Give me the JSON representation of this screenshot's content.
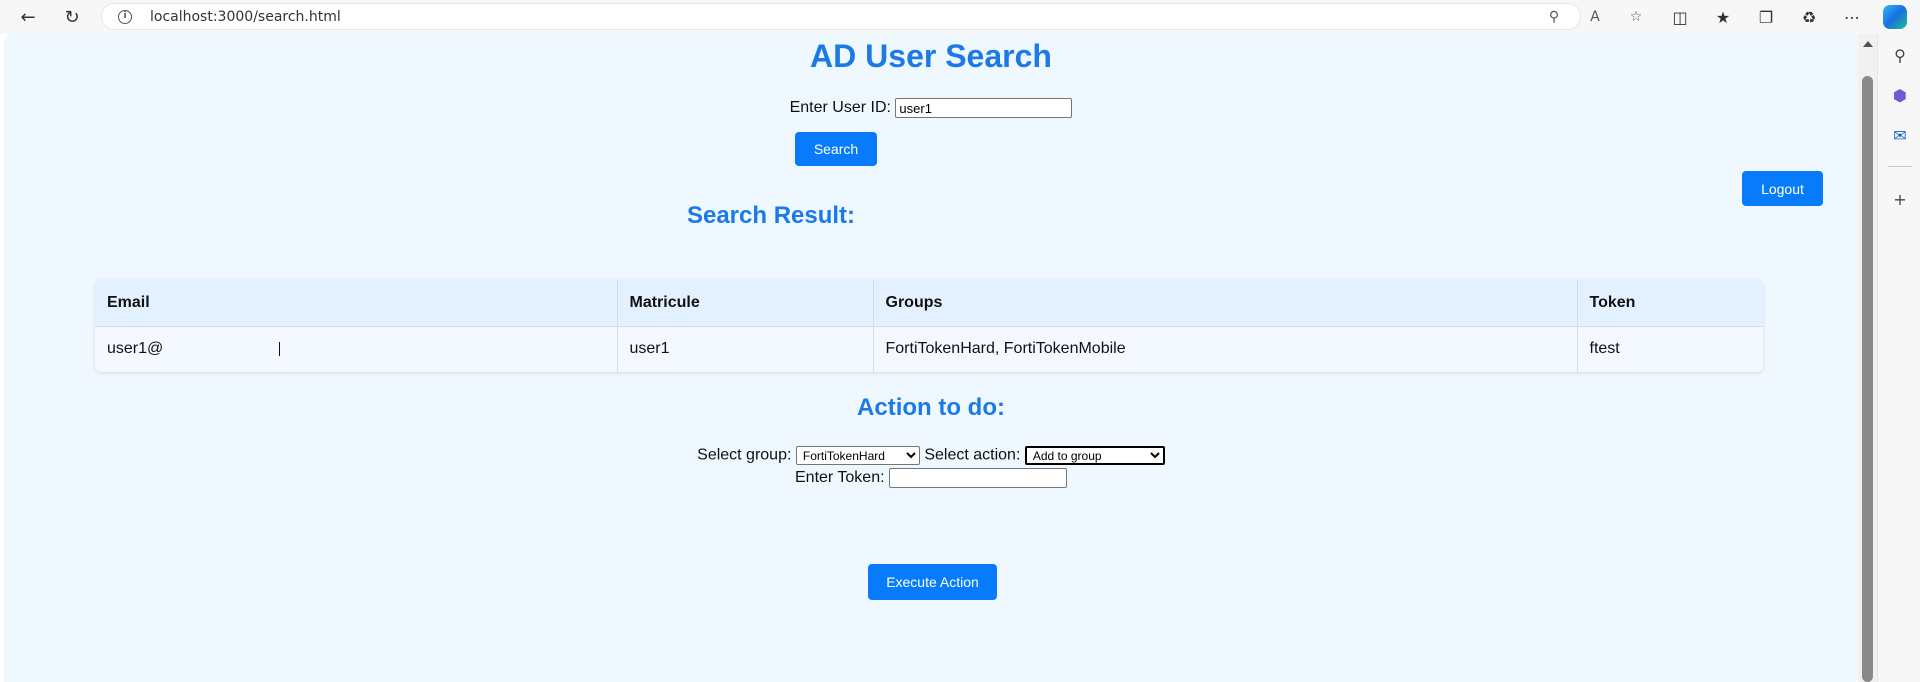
{
  "browser": {
    "url": "localhost:3000/search.html"
  },
  "page": {
    "title": "AD User Search",
    "search": {
      "label": "Enter User ID:",
      "value": "user1",
      "button": "Search"
    },
    "logout_button": "Logout",
    "results_title": "Search Result:",
    "table": {
      "headers": [
        "Email",
        "Matricule",
        "Groups",
        "Token"
      ],
      "rows": [
        [
          "user1@",
          "user1",
          "FortiTokenHard, FortiTokenMobile",
          "ftest"
        ]
      ]
    },
    "action_title": "Action to do:",
    "actions": {
      "group_label": "Select group:",
      "group_value": "FortiTokenHard",
      "action_label": "Select action:",
      "action_value": "Add to group",
      "token_label": "Enter Token:",
      "token_value": ""
    },
    "execute_button": "Execute Action"
  },
  "colors": {
    "accent": "#1b7ae6",
    "button": "#087bfa",
    "background": "#f0f8ff"
  }
}
